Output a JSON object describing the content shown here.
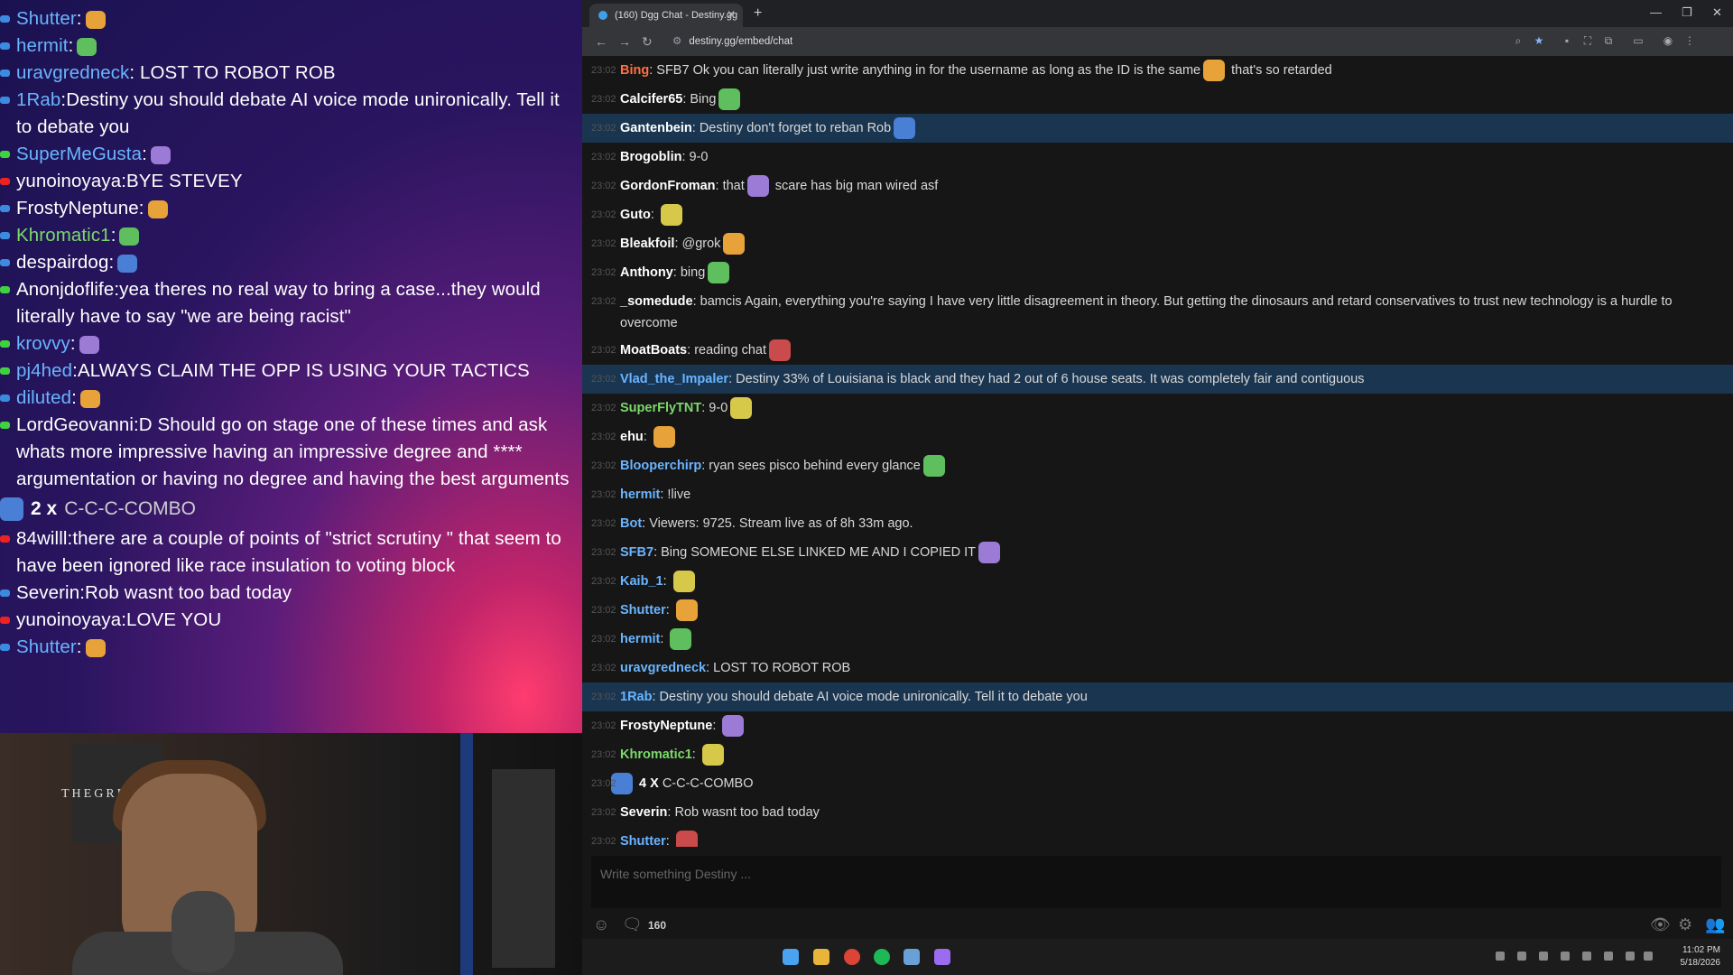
{
  "overlay": {
    "messages": [
      {
        "name": "Shutter",
        "sep": ":",
        "text": "",
        "color": "#6ab4ff",
        "badge": "#3b8ce0"
      },
      {
        "name": "hermit",
        "sep": ":",
        "text": "",
        "color": "#6ab4ff",
        "badge": "#3b8ce0"
      },
      {
        "name": "uravgredneck",
        "sep": ":",
        "text": " LOST TO ROBOT ROB",
        "color": "#6ab4ff",
        "badge": "#3b8ce0"
      },
      {
        "name": "1Rab",
        "sep": ":",
        "text": "Destiny you should debate AI voice mode unironically. Tell it to debate you",
        "color": "#6ab4ff",
        "badge": "#3b8ce0"
      },
      {
        "name": "SuperMeGusta",
        "sep": ":",
        "text": "",
        "color": "#6ab4ff",
        "badge": "#3fd13f"
      },
      {
        "name": "yunoinoyaya",
        "sep": ":",
        "text": "BYE STEVEY",
        "color": "#ffffff",
        "badge": "#e22"
      },
      {
        "name": "FrostyNeptune",
        "sep": ":",
        "text": "",
        "color": "#ffffff",
        "badge": "#3b8ce0"
      },
      {
        "name": "Khromatic1",
        "sep": ":",
        "text": "",
        "color": "#7bd96a",
        "badge": "#3b8ce0"
      },
      {
        "name": "despairdog",
        "sep": ":",
        "text": "",
        "color": "#ffffff",
        "badge": "#3b8ce0"
      },
      {
        "name": "Anonjdoflife",
        "sep": ":",
        "text": "yea theres no real way to bring a case...they would literally have to say \"we are being racist\"",
        "color": "#ffffff",
        "badge": "#3fd13f"
      },
      {
        "name": "krovvy",
        "sep": ":",
        "text": "",
        "color": "#6ab4ff",
        "badge": "#3fd13f"
      },
      {
        "name": "pj4hed",
        "sep": ":",
        "text": "ALWAYS CLAIM THE OPP IS USING YOUR TACTICS",
        "color": "#6ab4ff",
        "badge": "#3fd13f"
      },
      {
        "name": "diluted",
        "sep": ":",
        "text": "",
        "color": "#6ab4ff",
        "badge": "#3b8ce0"
      },
      {
        "name": "LordGeovanni",
        "sep": ":",
        "text": "D Should go on stage one of these times and ask whats more impressive having an impressive degree and **** argumentation or having no degree and having the best arguments",
        "color": "#ffffff",
        "badge": "#3fd13f"
      }
    ],
    "combo": {
      "count": "2",
      "x": "x",
      "label": "C-C-C-COMBO"
    },
    "messages2": [
      {
        "name": "84willl",
        "sep": ":",
        "text": "there are a couple of points of \"strict scrutiny \" that seem to have been ignored like race insulation to voting block",
        "color": "#ffffff",
        "badge": "#e22"
      },
      {
        "name": "Severin",
        "sep": ":",
        "text": "Rob wasnt too bad today",
        "color": "#ffffff",
        "badge": "#3b8ce0"
      },
      {
        "name": "yunoinoyaya",
        "sep": ":",
        "text": "LOVE YOU",
        "color": "#ffffff",
        "badge": "#e22"
      },
      {
        "name": "Shutter",
        "sep": ":",
        "text": "",
        "color": "#6ab4ff",
        "badge": "#3b8ce0"
      }
    ],
    "webcam_sign": "THEGREEN"
  },
  "browser": {
    "tab_title": "(160) Dgg Chat - Destiny.gg",
    "url": "destiny.gg/embed/chat"
  },
  "chat": {
    "messages": [
      {
        "ts": "23:02",
        "user": "Bing",
        "uclass": "o",
        "text": "SFB7 Ok you can literally just write anything in for the username as long as the ID is the same",
        "text2": "that's so retarded",
        "hl": false
      },
      {
        "ts": "23:02",
        "user": "Calcifer65",
        "uclass": "",
        "text": "Bing",
        "hl": false
      },
      {
        "ts": "23:02",
        "user": "Gantenbein",
        "uclass": "",
        "text": "Destiny don't forget to reban Rob",
        "hl": true
      },
      {
        "ts": "23:02",
        "user": "Brogoblin",
        "uclass": "",
        "text": "9-0",
        "hl": false
      },
      {
        "ts": "23:02",
        "user": "GordonFroman",
        "uclass": "",
        "text": "that",
        "text2": "scare has big man wired asf",
        "hl": false
      },
      {
        "ts": "23:02",
        "user": "Guto",
        "uclass": "",
        "text": "",
        "hl": false
      },
      {
        "ts": "23:02",
        "user": "Bleakfoil",
        "uclass": "",
        "text": "@grok",
        "hl": false
      },
      {
        "ts": "23:02",
        "user": "Anthony",
        "uclass": "",
        "text": "bing",
        "hl": false
      },
      {
        "ts": "23:02",
        "user": "_somedude",
        "uclass": "",
        "text": "bamcis Again, everything you're saying I have very little disagreement in theory. But getting the dinosaurs and retard conservatives to trust new technology is a hurdle to overcome",
        "hl": false,
        "multi": true
      },
      {
        "ts": "23:02",
        "user": "MoatBoats",
        "uclass": "",
        "text": "reading chat",
        "hl": false
      },
      {
        "ts": "23:02",
        "user": "Vlad_the_Impaler",
        "uclass": "b",
        "text": "Destiny 33% of Louisiana is black and they had 2 out of 6 house seats. It was completely fair and contiguous",
        "hl": true
      },
      {
        "ts": "23:02",
        "user": "SuperFlyTNT",
        "uclass": "g",
        "text": "9-0",
        "hl": false
      },
      {
        "ts": "23:02",
        "user": "ehu",
        "uclass": "",
        "text": "",
        "hl": false
      },
      {
        "ts": "23:02",
        "user": "Blooperchirp",
        "uclass": "b",
        "text": "ryan sees pisco behind every glance",
        "hl": false
      },
      {
        "ts": "23:02",
        "user": "hermit",
        "uclass": "b",
        "text": "!live",
        "hl": false
      },
      {
        "ts": "23:02",
        "user": "Bot",
        "uclass": "b",
        "text": "Viewers: 9725. Stream live as of 8h 33m ago.",
        "hl": false
      },
      {
        "ts": "23:02",
        "user": "SFB7",
        "uclass": "b",
        "text": "Bing SOMEONE ELSE LINKED ME AND I COPIED IT",
        "hl": false
      },
      {
        "ts": "23:02",
        "user": "Kaib_1",
        "uclass": "b",
        "text": "",
        "hl": false
      },
      {
        "ts": "23:02",
        "user": "Shutter",
        "uclass": "b",
        "text": "",
        "hl": false
      },
      {
        "ts": "23:02",
        "user": "hermit",
        "uclass": "b",
        "text": "",
        "hl": false
      },
      {
        "ts": "23:02",
        "user": "uravgredneck",
        "uclass": "b",
        "text": "LOST TO ROBOT ROB",
        "hl": false
      },
      {
        "ts": "23:02",
        "user": "1Rab",
        "uclass": "b",
        "text": "Destiny you should debate AI voice mode unironically. Tell it to debate you",
        "hl": true
      },
      {
        "ts": "23:02",
        "user": "FrostyNeptune",
        "uclass": "",
        "text": "",
        "hl": false
      },
      {
        "ts": "23:02",
        "user": "Khromatic1",
        "uclass": "g",
        "text": "",
        "hl": false
      }
    ],
    "combo": {
      "ts": "23:02",
      "count": "4",
      "x": "X",
      "label": "C-C-C-COMBO"
    },
    "messages_end": [
      {
        "ts": "23:02",
        "user": "Severin",
        "uclass": "",
        "text": "Rob wasnt too bad today",
        "hl": false
      },
      {
        "ts": "23:02",
        "user": "Shutter",
        "uclass": "b",
        "text": "",
        "hl": false
      }
    ],
    "input_placeholder": "Write something Destiny ...",
    "user_count": "160"
  },
  "taskbar": {
    "time": "11:02 PM",
    "date": "5/18/2026"
  }
}
